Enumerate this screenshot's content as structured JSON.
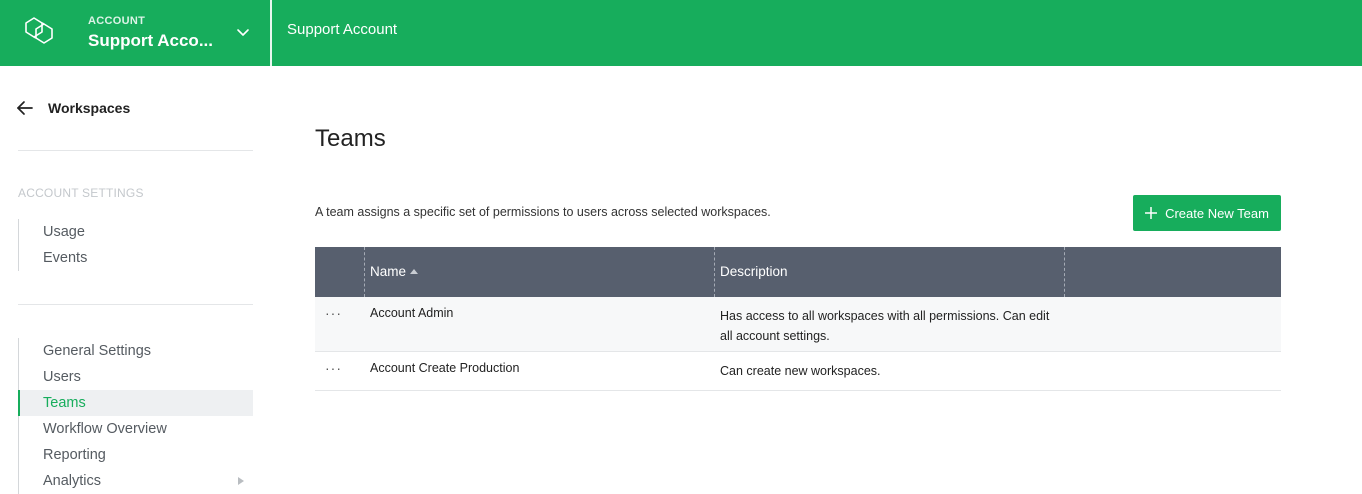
{
  "colors": {
    "brand": "#17ad5c",
    "table_header": "#575f6e"
  },
  "header": {
    "account_label": "ACCOUNT",
    "account_name": "Support Acco...",
    "title": "Support Account"
  },
  "sidebar": {
    "back_label": "Workspaces",
    "section_label": "ACCOUNT SETTINGS",
    "group1": [
      {
        "label": "Usage"
      },
      {
        "label": "Events"
      }
    ],
    "group2": [
      {
        "label": "General Settings"
      },
      {
        "label": "Users"
      },
      {
        "label": "Teams",
        "active": true
      },
      {
        "label": "Workflow Overview"
      },
      {
        "label": "Reporting"
      },
      {
        "label": "Analytics",
        "has_submenu": true
      }
    ]
  },
  "main": {
    "title": "Teams",
    "description": "A team assigns a specific set of permissions to users across selected workspaces.",
    "create_button": "Create New Team",
    "table": {
      "columns": [
        "Name",
        "Description"
      ],
      "sorted_column": "Name",
      "rows": [
        {
          "menu": "···",
          "name": "Account Admin",
          "description": "Has access to all workspaces with all permissions. Can edit all account settings."
        },
        {
          "menu": "···",
          "name": "Account Create Production",
          "description": "Can create new workspaces."
        }
      ]
    }
  }
}
